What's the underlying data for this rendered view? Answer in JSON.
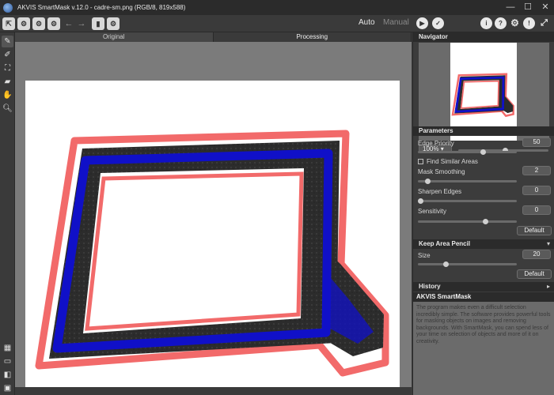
{
  "window": {
    "title": "AKVIS SmartMask v.12.0 - cadre-sm.png (RGB/8, 819x588)",
    "controls": {
      "minimize": "—",
      "maximize": "☐",
      "close": "✕"
    }
  },
  "toolbar": {
    "auto_label": "Auto",
    "manual_label": "Manual"
  },
  "tabs": [
    {
      "label": "Original"
    },
    {
      "label": "Processing"
    }
  ],
  "navigator": {
    "title": "Navigator",
    "zoom": "100%"
  },
  "parameters": {
    "title": "Parameters",
    "edge_priority": {
      "label": "Edge Priority",
      "value": "50"
    },
    "find_similar": {
      "label": "Find Similar Areas"
    },
    "mask_smoothing": {
      "label": "Mask Smoothing",
      "value": "2"
    },
    "sharpen_edges": {
      "label": "Sharpen Edges",
      "value": "0"
    },
    "sensitivity": {
      "label": "Sensitivity",
      "value": "0"
    },
    "default_label": "Default"
  },
  "keep_area": {
    "title": "Keep Area Pencil",
    "size": {
      "label": "Size",
      "value": "20"
    },
    "default_label": "Default"
  },
  "history": {
    "title": "History"
  },
  "help": {
    "title": "AKVIS SmartMask",
    "text": "The program makes even a difficult selection incredibly simple. The software provides powerful tools for masking objects on images and removing backgrounds. With SmartMask, you can spend less of your time on selection of objects and more of it on creativity."
  },
  "colors": {
    "frame_dark": "#2a2a2a",
    "frame_blue": "#1010c8",
    "outline_red": "#f26a6a",
    "panel_bg": "#3c3c3c",
    "canvas_bg": "#7b7b7b"
  }
}
